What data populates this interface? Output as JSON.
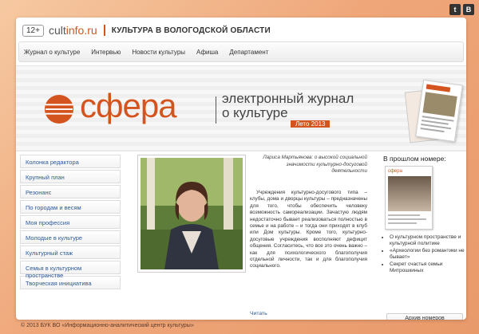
{
  "social": {
    "twitter": "t",
    "vk": "B"
  },
  "header": {
    "age_badge": "12+",
    "logo_main": "cult",
    "logo_accent": "info.ru",
    "title": "КУЛЬТУРА В ВОЛОГОДСКОЙ ОБЛАСТИ"
  },
  "nav": [
    "Журнал о культуре",
    "Интервью",
    "Новости культуры",
    "Афиша",
    "Департамент"
  ],
  "banner": {
    "brand": "сфера",
    "subtitle_line1": "электронный журнал",
    "subtitle_line2": "о культуре",
    "season": "Лето 2013",
    "brand_color": "#d4541f"
  },
  "sidebar": [
    "Колонка редактора",
    "Крупный план",
    "Резонанс",
    "По городам и весям",
    "Моя профессия",
    "Молодые в культуре",
    "Культурный стаж",
    "Семья в культурном пространстве",
    "Творческая инициатива"
  ],
  "article": {
    "caption": "Лариса Мартьянова: о высокой социальной значимости культурно-досуговой деятельности",
    "body": "Учреждения культурно-досугового типа – клубы, дома и дворцы культуры – предназначены для того, чтобы обеспечить человеку возможность самореализации. Зачастую людям недостаточно бывает реализоваться полностью в семье и на работе – и тогда они приходят в клуб или Дом культуры. Кроме того, культурно-досуговые учреждения восполняют дефицит общения. Согласитесь, что все это очень важно – как для психологического благополучия отдельной личности, так и для благополучия социального.",
    "read_more": "Читать"
  },
  "previous": {
    "title": "В прошлом номере:",
    "cover_logo": "сфера",
    "items": [
      "О культурном пространстве и культурной политике",
      "«Археологии без романтики не бывает»",
      "Секрет счастья семьи Митрошкиных"
    ],
    "archive_button": "Архив номеров"
  },
  "footer": "© 2013 БУК ВО «Информационно-аналитический центр культуры»"
}
